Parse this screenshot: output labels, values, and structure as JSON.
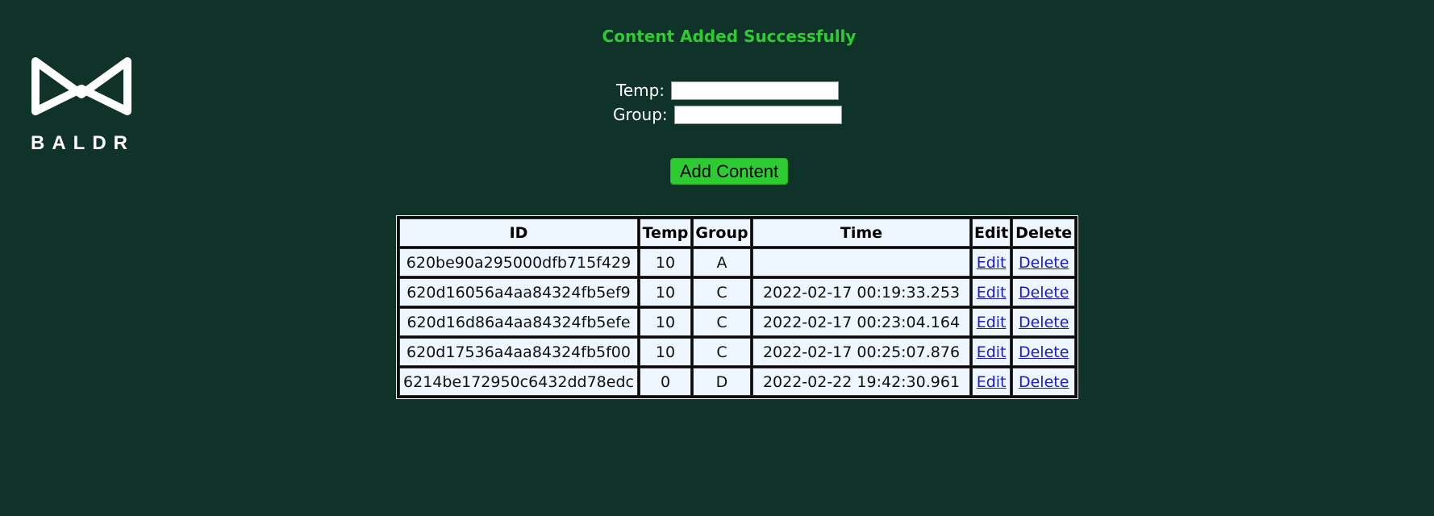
{
  "brand": {
    "name": "BALDR",
    "logo_icon": "bow-tie-logo-icon",
    "logo_color": "#ffffff"
  },
  "status": {
    "message": "Content Added Successfully",
    "color": "#2ecc33"
  },
  "form": {
    "temp_label": "Temp:",
    "temp_value": "",
    "group_label": "Group:",
    "group_value": "",
    "submit_label": "Add Content"
  },
  "table": {
    "headers": [
      "ID",
      "Temp",
      "Group",
      "Time",
      "Edit",
      "Delete"
    ],
    "rows": [
      {
        "id": "620be90a295000dfb715f429",
        "temp": "10",
        "group": "A",
        "time": "",
        "edit": "Edit",
        "delete": "Delete"
      },
      {
        "id": "620d16056a4aa84324fb5ef9",
        "temp": "10",
        "group": "C",
        "time": "2022-02-17 00:19:33.253",
        "edit": "Edit",
        "delete": "Delete"
      },
      {
        "id": "620d16d86a4aa84324fb5efe",
        "temp": "10",
        "group": "C",
        "time": "2022-02-17 00:23:04.164",
        "edit": "Edit",
        "delete": "Delete"
      },
      {
        "id": "620d17536a4aa84324fb5f00",
        "temp": "10",
        "group": "C",
        "time": "2022-02-17 00:25:07.876",
        "edit": "Edit",
        "delete": "Delete"
      },
      {
        "id": "6214be172950c6432dd78edc",
        "temp": "0",
        "group": "D",
        "time": "2022-02-22 19:42:30.961",
        "edit": "Edit",
        "delete": "Delete"
      }
    ]
  },
  "colors": {
    "background": "#0f3329",
    "cell_background": "#eef6ff",
    "link": "#1a1acc"
  }
}
